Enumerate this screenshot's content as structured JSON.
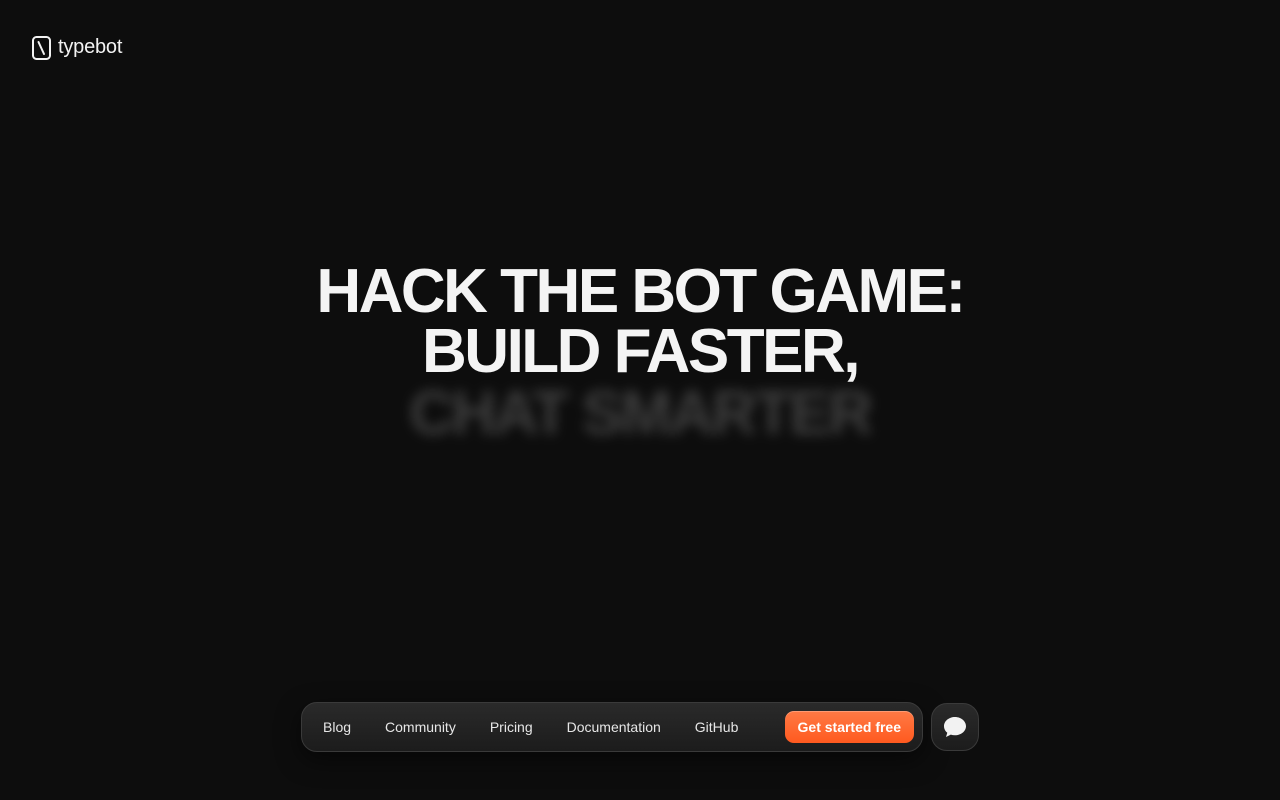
{
  "brand": {
    "name": "typebot",
    "logo_icon": "typebot-logo-icon"
  },
  "hero": {
    "line1": "HACK THE BOT GAME:",
    "line2": "BUILD FASTER,",
    "line3": "CHAT SMARTER"
  },
  "nav": {
    "items": [
      {
        "label": "Blog"
      },
      {
        "label": "Community"
      },
      {
        "label": "Pricing"
      },
      {
        "label": "Documentation"
      },
      {
        "label": "GitHub"
      }
    ],
    "cta_label": "Get started free"
  },
  "chat": {
    "icon": "chat-bubble-icon"
  },
  "colors": {
    "background": "#0d0d0d",
    "accent": "#ff5a1f",
    "text": "#f4f4f4"
  }
}
